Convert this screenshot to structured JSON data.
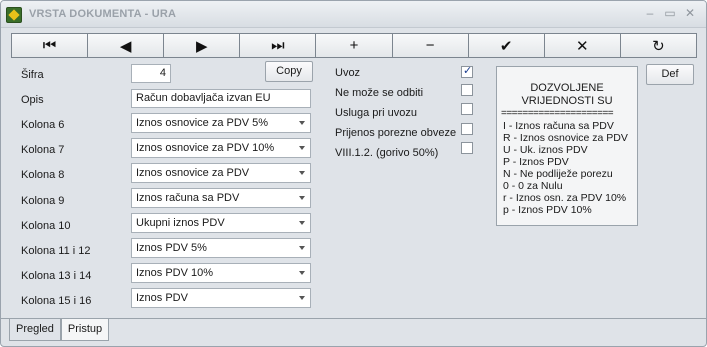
{
  "window": {
    "title": "VRSTA DOKUMENTA - URA",
    "controls": [
      "–",
      "▭",
      "✕"
    ]
  },
  "toolbar": {
    "buttons": [
      {
        "name": "first-record-icon",
        "glyph": "⏮"
      },
      {
        "name": "previous-record-icon",
        "glyph": "◀"
      },
      {
        "name": "next-record-icon",
        "glyph": "▶"
      },
      {
        "name": "last-record-icon",
        "glyph": "⏭"
      },
      {
        "name": "add-icon",
        "glyph": "+"
      },
      {
        "name": "delete-icon",
        "glyph": "−"
      },
      {
        "name": "confirm-icon",
        "glyph": "✔"
      },
      {
        "name": "cancel-icon",
        "glyph": "✕"
      },
      {
        "name": "refresh-icon",
        "glyph": "↻"
      }
    ]
  },
  "form": {
    "sifra_label": "Šifra",
    "sifra_value": "4",
    "copy_label": "Copy",
    "opis_label": "Opis",
    "opis_value": "Račun dobavljača izvan EU",
    "columns": [
      {
        "label": "Kolona 6",
        "value": "Iznos osnovice za PDV 5%"
      },
      {
        "label": "Kolona 7",
        "value": "Iznos osnovice za PDV 10%"
      },
      {
        "label": "Kolona 8",
        "value": "Iznos osnovice za PDV"
      },
      {
        "label": "Kolona 9",
        "value": "Iznos računa sa PDV"
      },
      {
        "label": "Kolona 10",
        "value": "Ukupni iznos PDV"
      },
      {
        "label": "Kolona 11 i 12",
        "value": "Iznos PDV 5%"
      },
      {
        "label": "Kolona 13 i 14",
        "value": "Iznos PDV 10%"
      },
      {
        "label": "Kolona 15 i 16",
        "value": "Iznos PDV"
      }
    ],
    "checks": [
      {
        "label": "Uvoz",
        "checked": true
      },
      {
        "label": "Ne može se odbiti",
        "checked": false
      },
      {
        "label": "Usluga pri uvozu",
        "checked": false
      },
      {
        "label": "Prijenos porezne obveze",
        "checked": false
      },
      {
        "label": "VIII.1.2. (gorivo 50%)",
        "checked": false
      }
    ],
    "def_label": "Def"
  },
  "info": {
    "head1": "DOZVOLJENE",
    "head2": "VRIJEDNOSTI SU",
    "separator": "=====================",
    "lines": [
      "I  - Iznos računa sa PDV",
      "R - Iznos osnovice za PDV",
      "U - Uk. iznos PDV",
      "P - Iznos PDV",
      "N - Ne podliježe porezu",
      "0 - 0 za Nulu",
      "r - Iznos osn. za PDV 10%",
      "p - Iznos PDV 10%"
    ]
  },
  "tabs": [
    {
      "label": "Pregled",
      "active": true
    },
    {
      "label": "Pristup",
      "active": false
    }
  ]
}
